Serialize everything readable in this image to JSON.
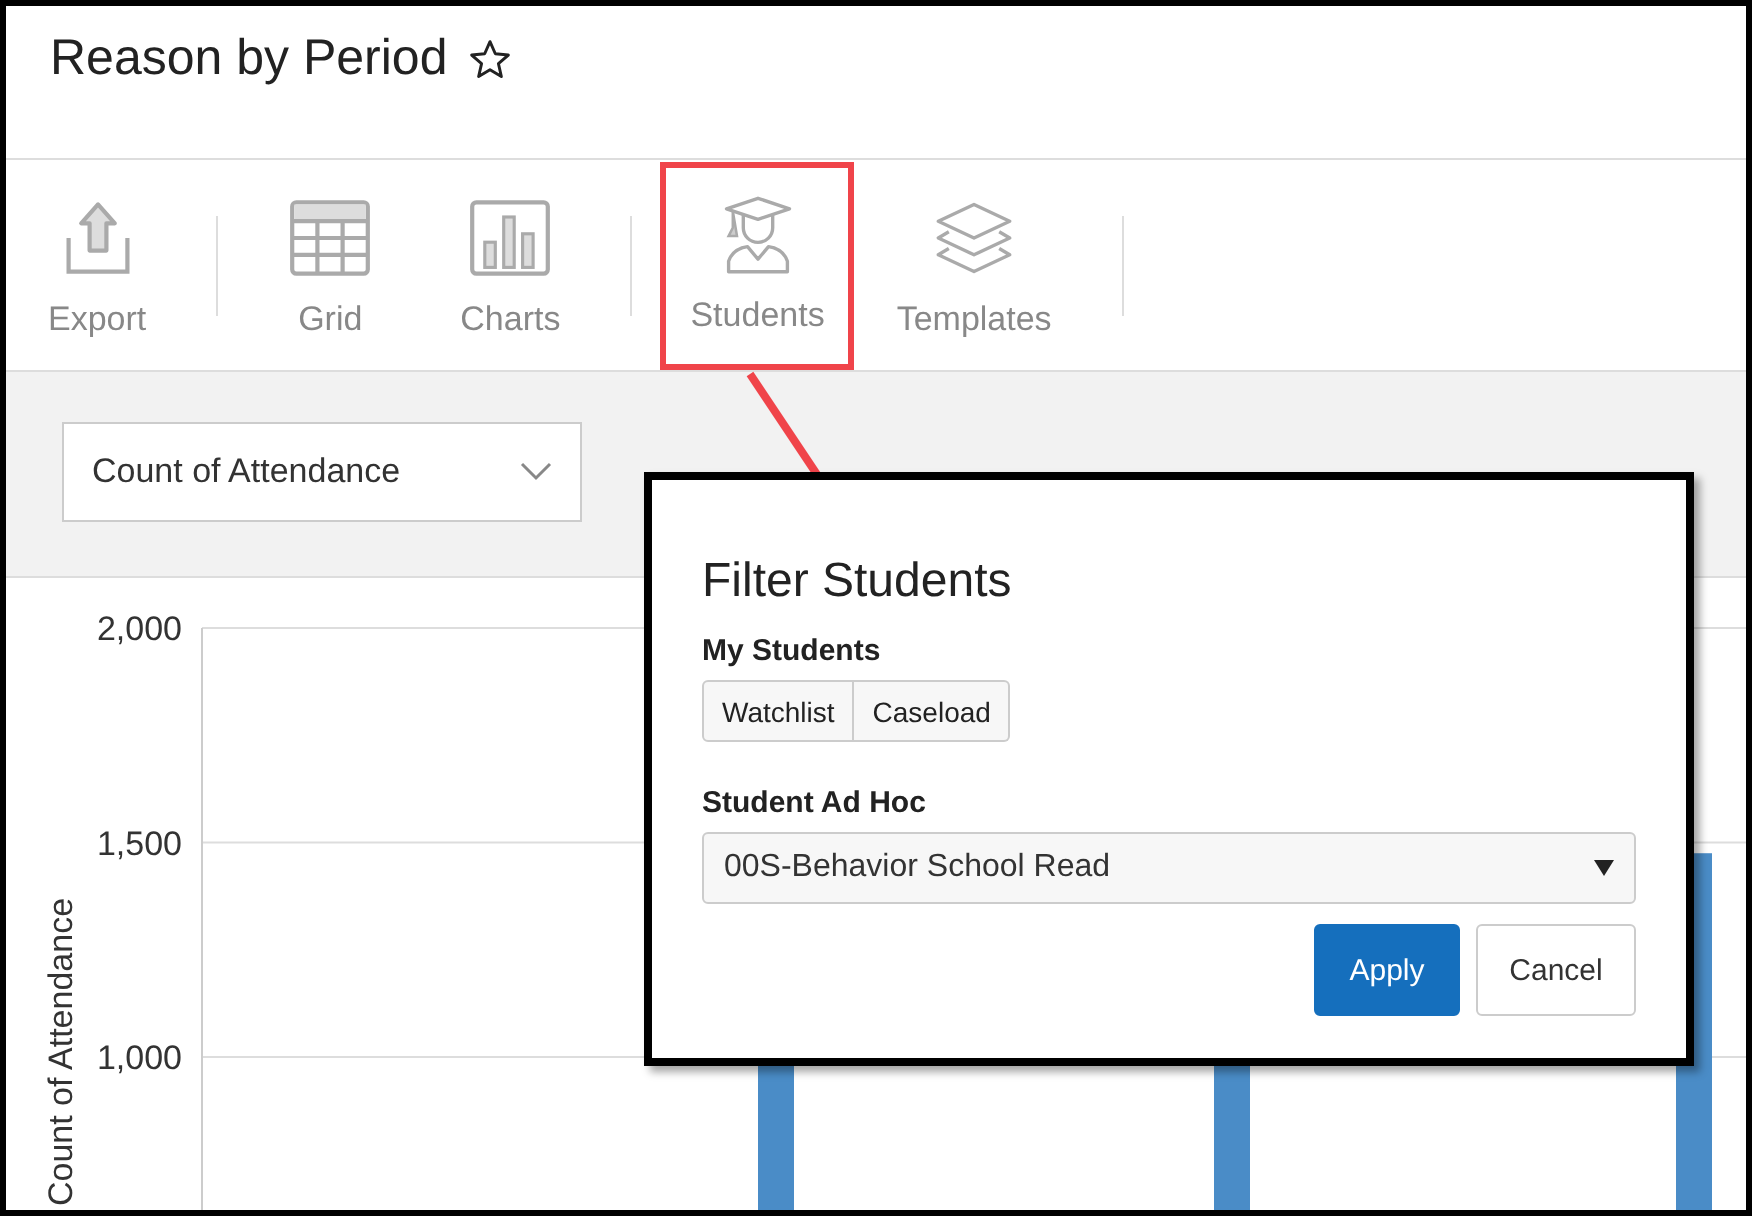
{
  "page": {
    "title": "Reason by Period",
    "favorite": false
  },
  "toolbar_groups": [
    {
      "items": [
        {
          "label": "Export",
          "kind": "export",
          "highlighted": false
        }
      ]
    },
    {
      "items": [
        {
          "label": "Grid",
          "kind": "grid",
          "highlighted": false
        },
        {
          "label": "Charts",
          "kind": "charts",
          "highlighted": false
        }
      ]
    },
    {
      "items": [
        {
          "label": "Students",
          "kind": "students",
          "highlighted": true
        },
        {
          "label": "Templates",
          "kind": "templates",
          "highlighted": false
        }
      ]
    }
  ],
  "measure_select": {
    "value": "Count of Attendance"
  },
  "chart": {
    "chart_data": {
      "type": "bar",
      "ylabel": "Count of Attendance",
      "ylim": [
        0,
        2000
      ],
      "yticks": [
        {
          "value": 1000,
          "label": "1,000"
        },
        {
          "value": 1500,
          "label": "1,500"
        },
        {
          "value": 2000,
          "label": "2,000"
        }
      ],
      "values": [
        null,
        null,
        1475
      ]
    }
  },
  "filter_popup": {
    "title": "Filter Students",
    "my_students": {
      "label": "My Students",
      "buttons": [
        "Watchlist",
        "Caseload"
      ]
    },
    "ad_hoc": {
      "label": "Student Ad Hoc",
      "value": "00S-Behavior School Read"
    },
    "buttons": [
      {
        "label": "Apply",
        "kind": "primary"
      },
      {
        "label": "Cancel",
        "kind": "secondary"
      }
    ]
  }
}
